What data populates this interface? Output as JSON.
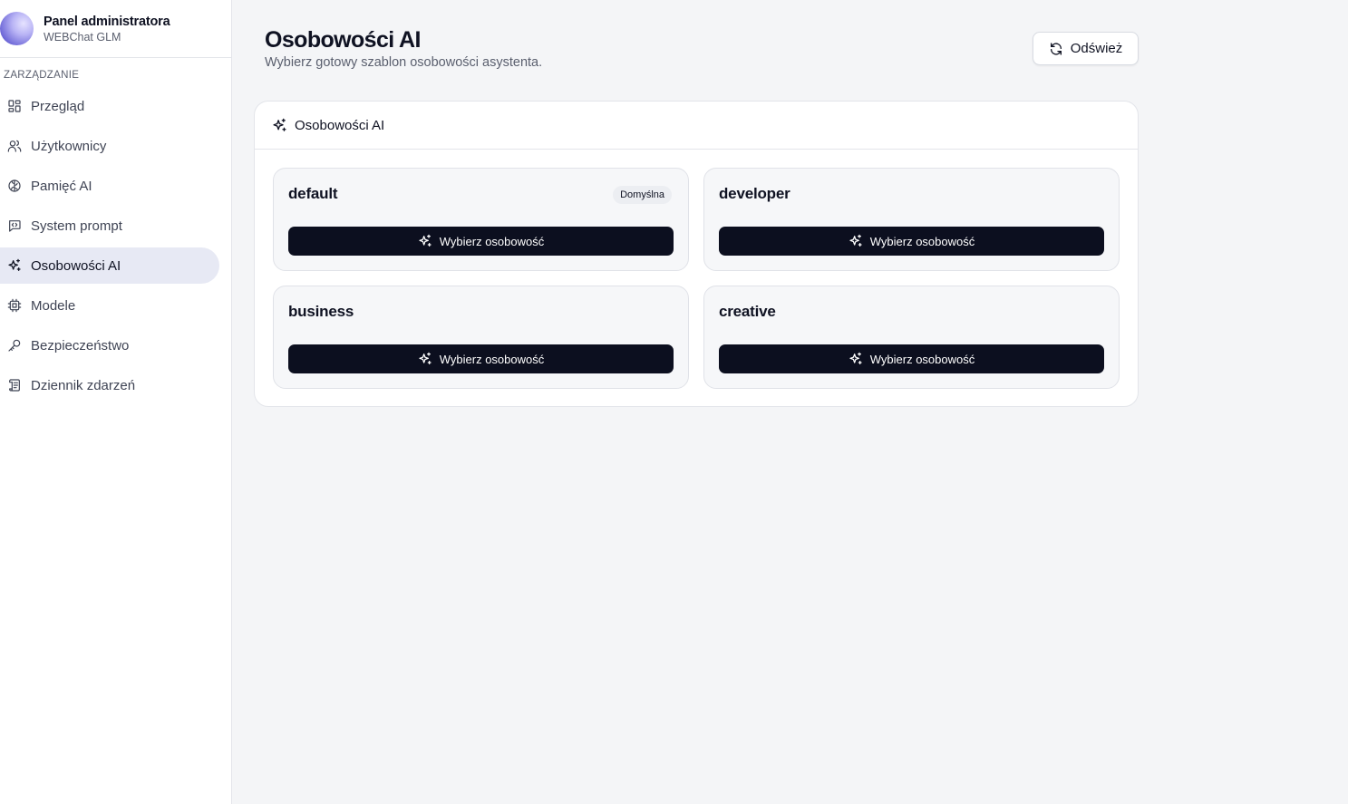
{
  "sidebar": {
    "title": "Panel administratora",
    "subtitle": "WEBChat GLM",
    "section_label": "ZARZĄDZANIE",
    "items": [
      {
        "label": "Przegląd",
        "icon": "dashboard-icon"
      },
      {
        "label": "Użytkownicy",
        "icon": "users-icon"
      },
      {
        "label": "Pamięć AI",
        "icon": "brain-icon"
      },
      {
        "label": "System prompt",
        "icon": "message-code-icon"
      },
      {
        "label": "Osobowości AI",
        "icon": "sparkles-icon",
        "active": true
      },
      {
        "label": "Modele",
        "icon": "cpu-icon"
      },
      {
        "label": "Bezpieczeństwo",
        "icon": "key-icon"
      },
      {
        "label": "Dziennik zdarzeń",
        "icon": "scroll-icon"
      }
    ]
  },
  "main": {
    "title": "Osobowości AI",
    "subtitle": "Wybierz gotowy szablon osobowości asystenta.",
    "refresh_label": "Odśwież",
    "card_title": "Osobowości AI",
    "select_label": "Wybierz osobowość",
    "personas": [
      {
        "name": "default",
        "badge": "Domyślna"
      },
      {
        "name": "developer",
        "badge": ""
      },
      {
        "name": "business",
        "badge": ""
      },
      {
        "name": "creative",
        "badge": ""
      }
    ]
  },
  "colors": {
    "accent_dark": "#0c0f1f",
    "active_nav": "#e7e9f4",
    "background": "#f4f5f7"
  }
}
